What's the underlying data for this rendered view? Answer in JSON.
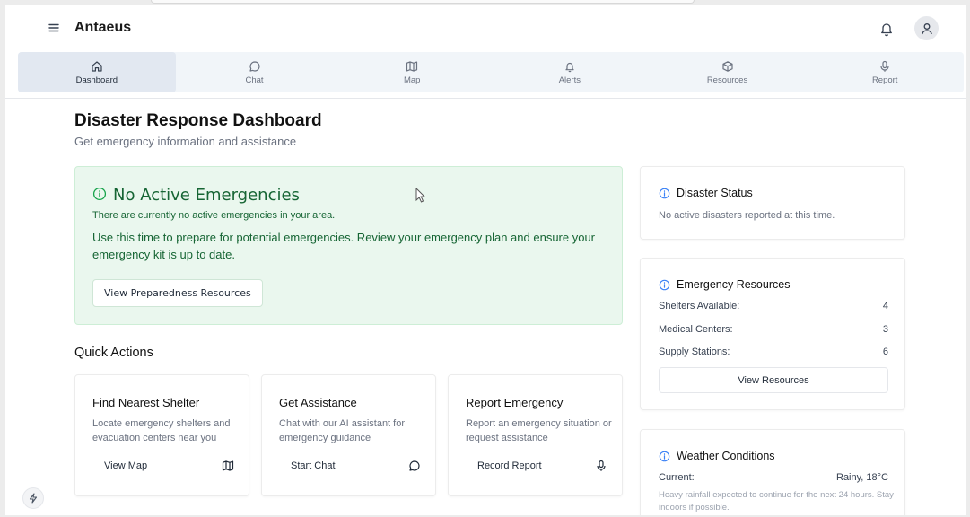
{
  "app": {
    "title": "Antaeus"
  },
  "tabs": [
    {
      "label": "Dashboard",
      "icon": "home-icon",
      "active": true
    },
    {
      "label": "Chat",
      "icon": "chat-bubble-icon"
    },
    {
      "label": "Map",
      "icon": "map-icon"
    },
    {
      "label": "Alerts",
      "icon": "bell-icon"
    },
    {
      "label": "Resources",
      "icon": "package-icon"
    },
    {
      "label": "Report",
      "icon": "microphone-icon"
    }
  ],
  "page": {
    "title": "Disaster Response Dashboard",
    "subtitle": "Get emergency information and assistance"
  },
  "alert": {
    "title": "No Active Emergencies",
    "description": "There are currently no active emergencies in your area.",
    "body": "Use this time to prepare for potential emergencies. Review your emergency plan and ensure your emergency kit is up to date.",
    "button": "View Preparedness Resources",
    "colors": {
      "background": "#eaf7ee",
      "text": "#166534"
    }
  },
  "quick_actions": {
    "title": "Quick Actions",
    "items": [
      {
        "title": "Find Nearest Shelter",
        "description": "Locate emergency shelters and evacuation centers near you",
        "button": "View Map",
        "icon": "map-icon"
      },
      {
        "title": "Get Assistance",
        "description": "Chat with our AI assistant for emergency guidance",
        "button": "Start Chat",
        "icon": "chat-bubble-icon"
      },
      {
        "title": "Report Emergency",
        "description": "Report an emergency situation or request assistance",
        "button": "Record Report",
        "icon": "microphone-icon"
      }
    ]
  },
  "disaster_status": {
    "title": "Disaster Status",
    "text": "No active disasters reported at this time."
  },
  "emergency_resources": {
    "title": "Emergency Resources",
    "rows": [
      {
        "label": "Shelters Available:",
        "value": "4"
      },
      {
        "label": "Medical Centers:",
        "value": "3"
      },
      {
        "label": "Supply Stations:",
        "value": "6"
      }
    ],
    "button": "View Resources"
  },
  "weather": {
    "title": "Weather Conditions",
    "current_label": "Current:",
    "current_value": "Rainy, 18°C",
    "note": "Heavy rainfall expected to continue for the next 24 hours. Stay indoors if possible."
  }
}
